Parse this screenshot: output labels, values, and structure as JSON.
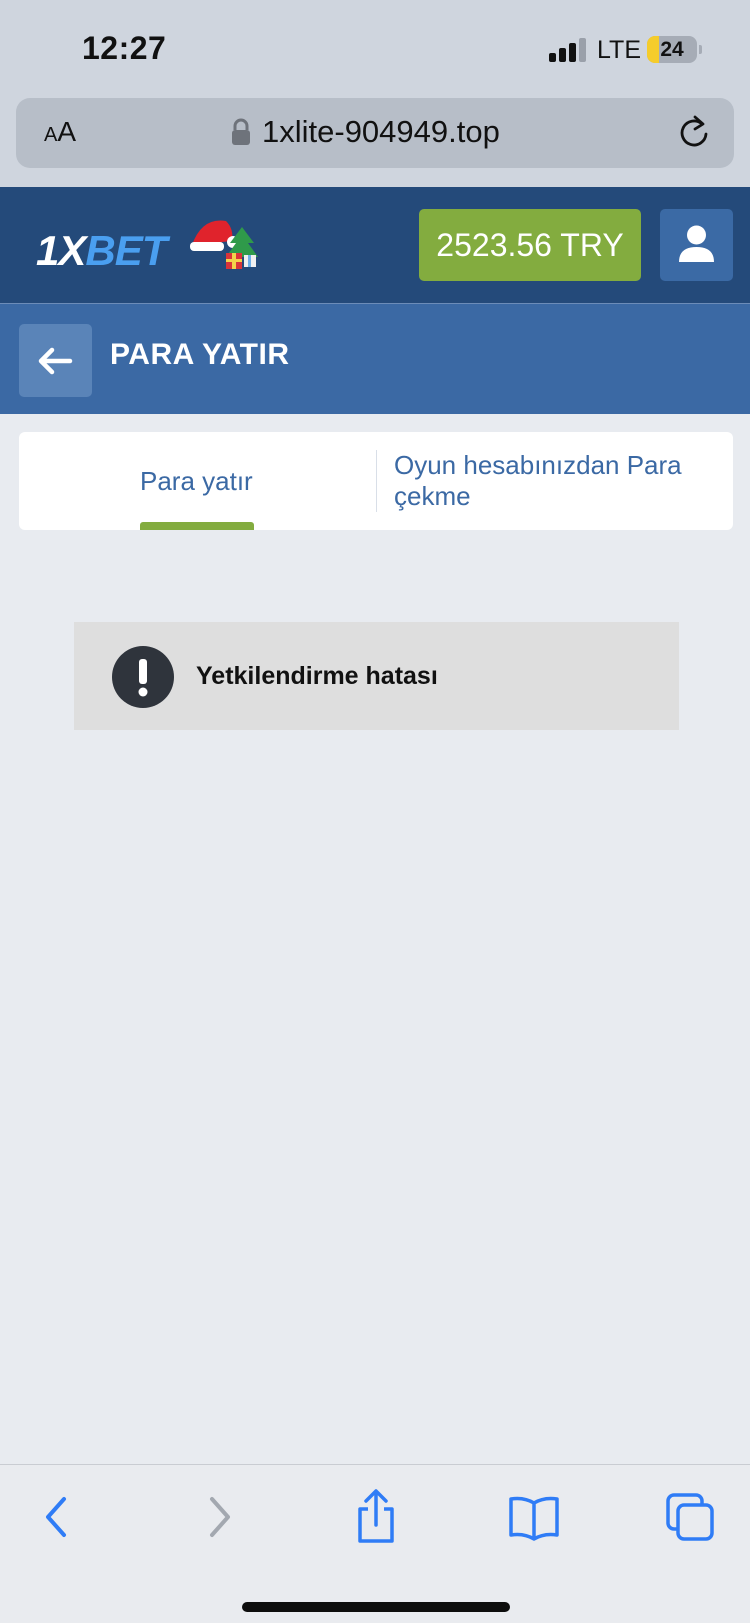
{
  "status_bar": {
    "time": "12:27",
    "carrier": "LTE",
    "battery": "24"
  },
  "browser": {
    "text_size_label_small": "A",
    "text_size_label_large": "A",
    "url": "1xlite-904949.top"
  },
  "header": {
    "logo_number": "1X",
    "logo_word": "BET",
    "balance": "2523.56 TRY"
  },
  "page": {
    "title": "PARA YATIR"
  },
  "tabs": [
    {
      "label": "Para yatır",
      "active": true
    },
    {
      "label": "Oyun hesabınızdan Para çekme",
      "active": false
    }
  ],
  "error": {
    "message": "Yetkilendirme hatası"
  },
  "colors": {
    "header_bg": "#244a7a",
    "title_bar_bg": "#3b69a4",
    "accent_green": "#83ac3f",
    "link_blue": "#3b69a4",
    "ios_blue": "#2f7cf6"
  },
  "icons": {
    "back": "arrow-left-icon",
    "profile": "user-icon",
    "error": "exclamation-icon",
    "lock": "lock-icon",
    "reload": "reload-icon",
    "toolbar": [
      "chevron-left-icon",
      "chevron-right-icon",
      "share-icon",
      "bookmarks-icon",
      "tabs-icon"
    ]
  }
}
